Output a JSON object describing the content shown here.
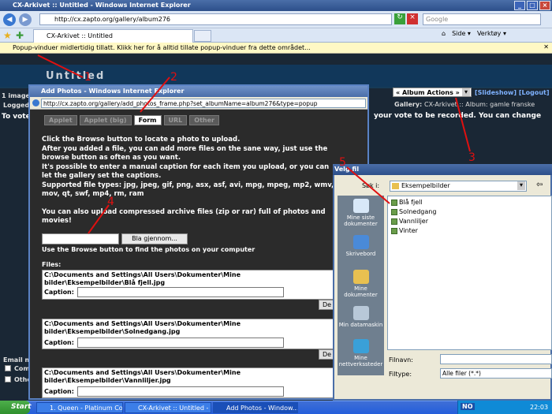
{
  "ie": {
    "title": "CX-Arkivet :: Untitled - Windows Internet Explorer",
    "url": "http://cx.zapto.org/gallery/album276",
    "search_placeholder": "Google",
    "tab_label": "CX-Arkivet :: Untitled",
    "tools": [
      "Side ▾",
      "Verktøy ▾"
    ],
    "popup_notice": "Popup-vinduer midlertidig tillatt. Klikk her for å alltid tillate popup-vinduer fra dette området..."
  },
  "gallery_page": {
    "title": "Untitled",
    "image_count": "1 image",
    "logged_in": "Logged i",
    "album_actions": "« Album Actions »",
    "slideshow": "[Slideshow]",
    "logout": "[Logout]",
    "gallery_label": "Gallery:",
    "gallery_value": "CX-Arkivet :: Album: gamle franske",
    "vote_left": "To vote",
    "vote_text": "your vote to be recorded. You can change",
    "email_label": "Email m",
    "check1": "Comm",
    "check2": "Othe"
  },
  "popup": {
    "title": "Add Photos - Windows Internet Explorer",
    "url": "http://cx.zapto.org/gallery/add_photos_frame.php?set_albumName=album276&type=popup",
    "tabs": [
      "Applet",
      "Applet (big)",
      "Form",
      "URL",
      "Other"
    ],
    "instructions": [
      "Click the Browse button to locate a photo to upload.",
      "After you added a file, you can add more files on the sane way, just use the browse button as often as you want.",
      "It's possible to enter a manual caption for each item you upload, or you can let the gallery set the captions.",
      "Supported file types: jpg, jpeg, gif, png, asx, asf, avi, mpg, mpeg, mp2, wmv, mov, qt, swf, mp4, rm, ram",
      "",
      "You can also upload compressed archive files (zip or rar) full of photos and movies!"
    ],
    "browse_label": "Bla gjennom...",
    "use_browse": "Use the Browse button to find the photos on your computer",
    "files_label": "Files:",
    "caption_label": "Caption:",
    "delete_label": "De",
    "files": [
      "C:\\Documents and Settings\\All Users\\Dokumenter\\Mine bilder\\Eksempelbilder\\Blå fjell.jpg",
      "C:\\Documents and Settings\\All Users\\Dokumenter\\Mine bilder\\Eksempelbilder\\Solnedgang.jpg",
      "C:\\Documents and Settings\\All Users\\Dokumenter\\Mine bilder\\Eksempelbilder\\Vannliljer.jpg"
    ]
  },
  "dialog": {
    "title": "Velg fil",
    "lookin_label": "Søk i:",
    "lookin_value": "Eksempelbilder",
    "places": [
      "Mine siste dokumenter",
      "Skrivebord",
      "Mine dokumenter",
      "Min datamaskin",
      "Mine nettverkssteder"
    ],
    "files": [
      "Blå fjell",
      "Solnedgang",
      "Vannliljer",
      "Vinter"
    ],
    "filename_label": "Filnavn:",
    "filetype_label": "Filtype:",
    "filetype_value": "Alle filer (*.*)"
  },
  "taskbar": {
    "start": "Start",
    "items": [
      "1. Queen - Platinum Coll...",
      "CX-Arkivet :: Untitled - ...",
      "Add Photos - Window..."
    ],
    "lang": "NO",
    "clock": "22:03"
  },
  "annotations": [
    "1",
    "2",
    "3",
    "4",
    "5"
  ]
}
